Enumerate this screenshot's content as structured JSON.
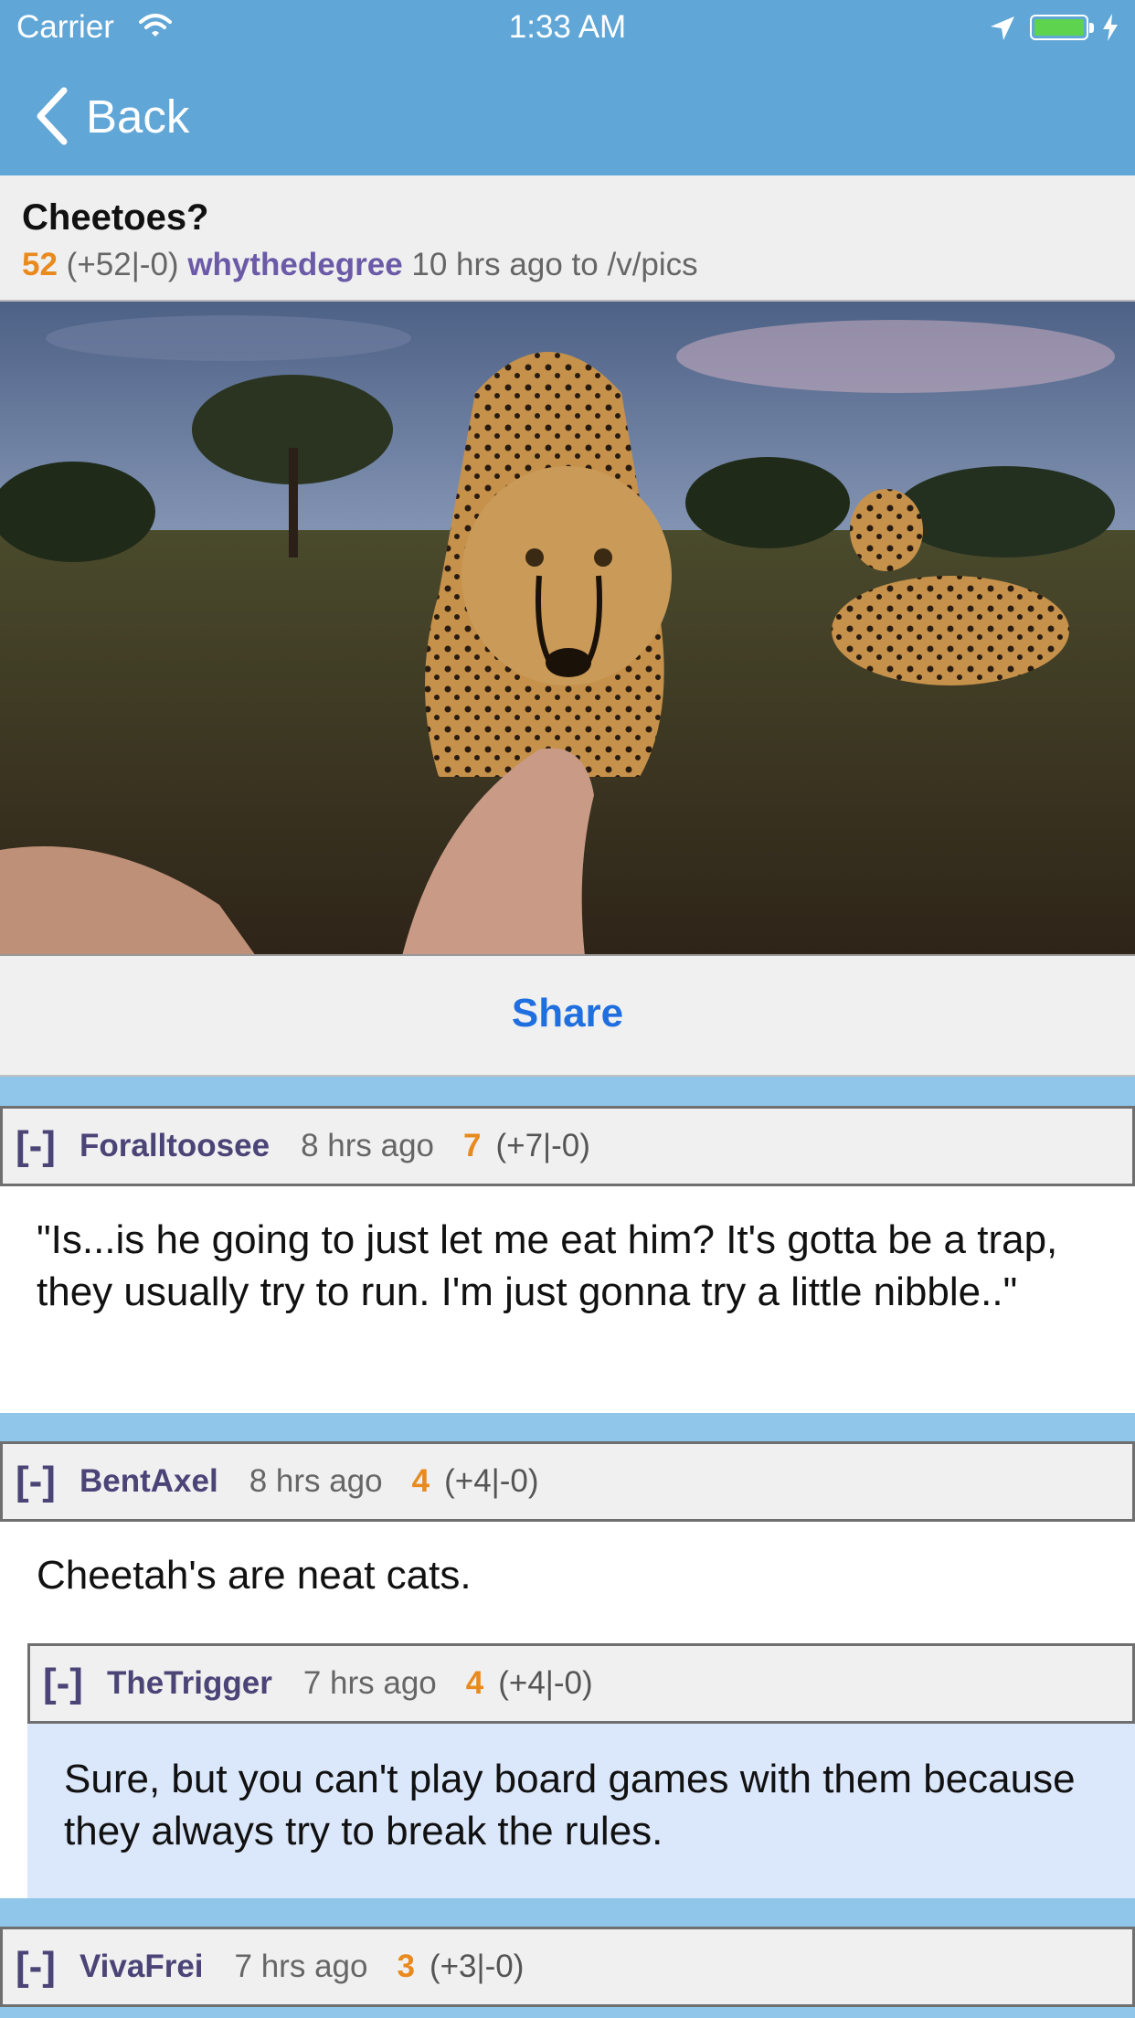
{
  "status_bar": {
    "carrier": "Carrier",
    "time": "1:33 AM"
  },
  "nav": {
    "back_label": "Back"
  },
  "post": {
    "title": "Cheetoes?",
    "score": "52",
    "votes": "(+52|-0)",
    "author": "whythedegree",
    "time": "10 hrs ago",
    "to": "to",
    "subverse": "/v/pics"
  },
  "share_label": "Share",
  "comments": [
    {
      "collapse": "[-]",
      "user": "Foralltoosee",
      "time": "8 hrs ago",
      "score": "7",
      "votes": "(+7|-0)",
      "body": "\"Is...is he going to just let me eat him?  It's gotta be a trap, they usually try to run.  I'm just gonna try a little nibble..\""
    },
    {
      "collapse": "[-]",
      "user": "BentAxel",
      "time": "8 hrs ago",
      "score": "4",
      "votes": "(+4|-0)",
      "body": "Cheetah's are neat cats."
    },
    {
      "collapse": "[-]",
      "user": "TheTrigger",
      "time": "7 hrs ago",
      "score": "4",
      "votes": "(+4|-0)",
      "body": "Sure, but you can't play board games with them because they always try to break the rules."
    },
    {
      "collapse": "[-]",
      "user": "VivaFrei",
      "time": "7 hrs ago",
      "score": "3",
      "votes": "(+3|-0)"
    }
  ],
  "colors": {
    "nav_bar": "#60a6d6",
    "accent_blue": "#1f6fe0",
    "score_orange": "#e98a1e",
    "username_purple": "#4b4477",
    "reply_background": "#dbe7fb"
  },
  "icons": [
    "wifi-icon",
    "location-arrow-icon",
    "battery-icon",
    "charging-bolt-icon",
    "back-chevron-icon"
  ]
}
